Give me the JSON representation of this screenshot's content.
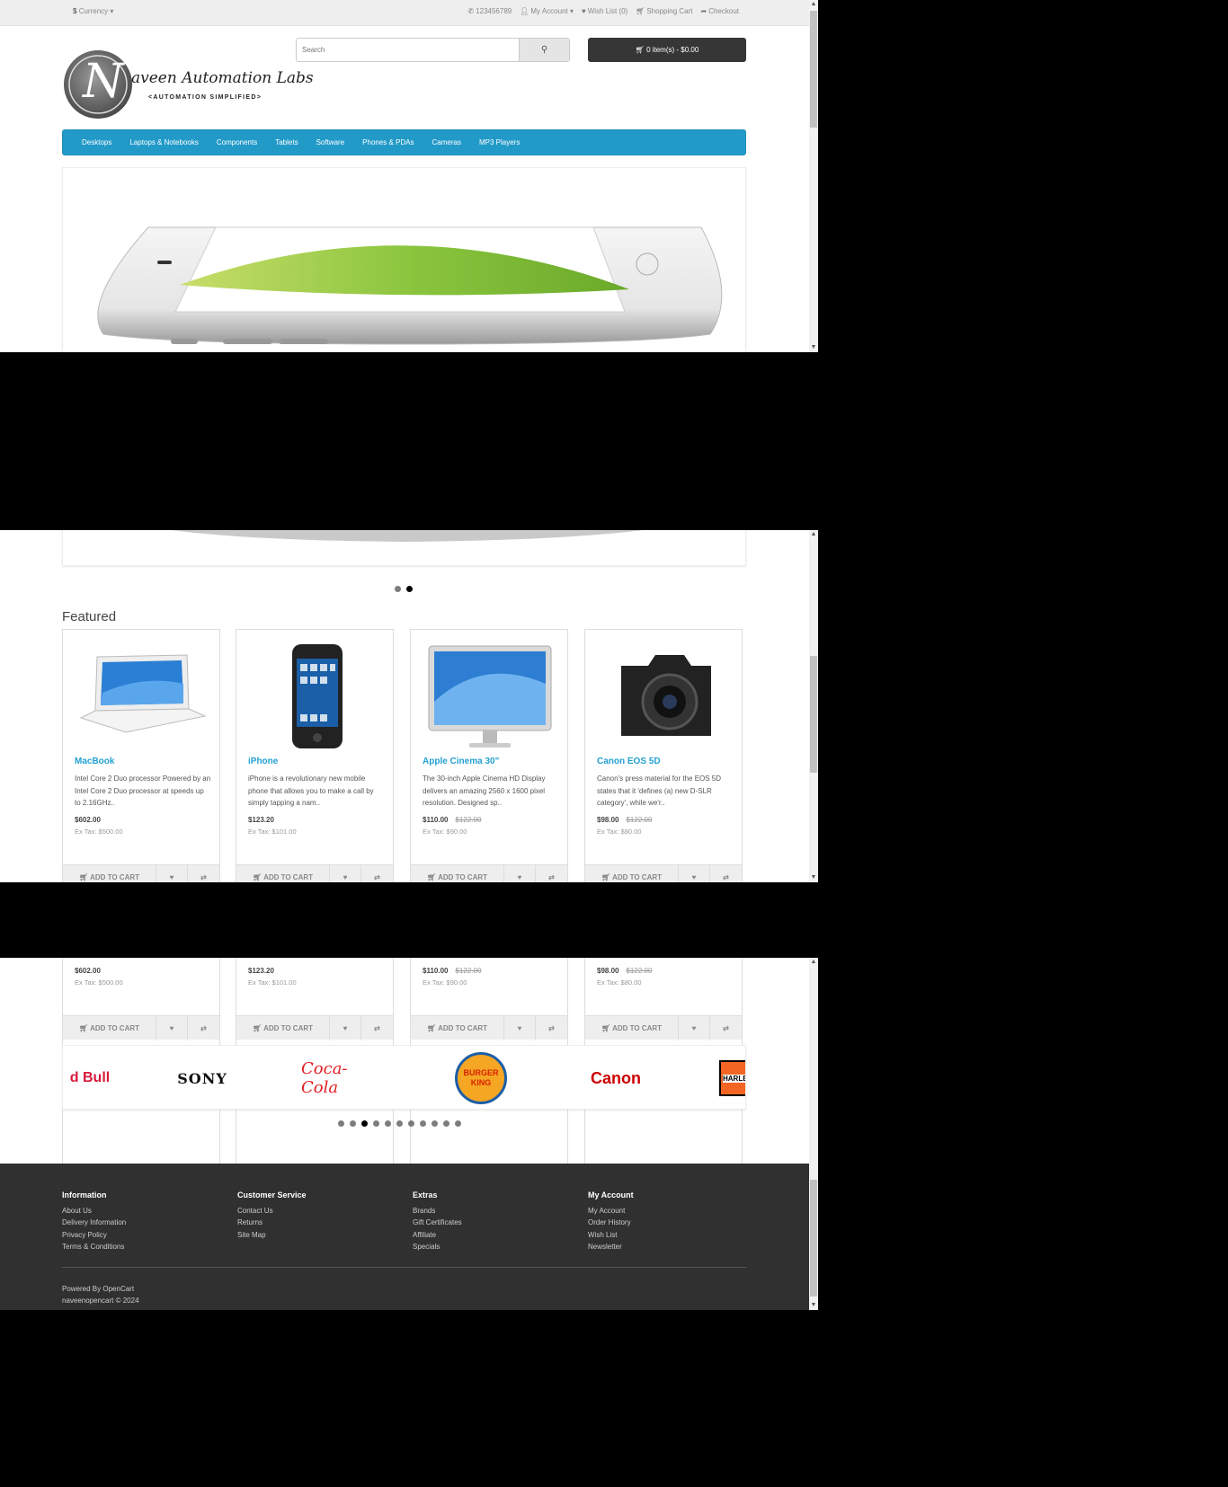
{
  "topbar": {
    "currency_symbol": "$",
    "currency_label": "Currency",
    "phone": "123456789",
    "my_account": "My Account",
    "wish_list": "Wish List (0)",
    "shopping_cart": "Shopping Cart",
    "checkout": "Checkout"
  },
  "logo": {
    "letter": "N",
    "name": "aveen Automation Labs",
    "tagline": "<AUTOMATION SIMPLIFIED>"
  },
  "search": {
    "placeholder": "Search"
  },
  "cart": {
    "label": "0 item(s) - $0.00"
  },
  "menu": [
    "Desktops",
    "Laptops & Notebooks",
    "Components",
    "Tablets",
    "Software",
    "Phones & PDAs",
    "Cameras",
    "MP3 Players"
  ],
  "featured": {
    "heading": "Featured",
    "add_to_cart": "ADD TO CART",
    "products": [
      {
        "name": "MacBook",
        "desc": "Intel Core 2 Duo processor Powered by an Intel Core 2 Duo processor at speeds up to 2.16GHz..",
        "price": "$602.00",
        "old_price": "",
        "ex_tax": "Ex Tax: $500.00"
      },
      {
        "name": "iPhone",
        "desc": "iPhone is a revolutionary new mobile phone that allows you to make a call by simply tapping a nam..",
        "price": "$123.20",
        "old_price": "",
        "ex_tax": "Ex Tax: $101.00"
      },
      {
        "name": "Apple Cinema 30\"",
        "desc": "The 30-inch Apple Cinema HD Display delivers an amazing 2560 x 1600 pixel resolution. Designed sp..",
        "price": "$110.00",
        "old_price": "$122.00",
        "ex_tax": "Ex Tax: $90.00"
      },
      {
        "name": "Canon EOS 5D",
        "desc": "Canon's press material for the EOS 5D states that it 'defines (a) new D-SLR category', while we'r..",
        "price": "$98.00",
        "old_price": "$122.00",
        "ex_tax": "Ex Tax: $80.00"
      }
    ]
  },
  "brands": [
    "d Bull",
    "SONY",
    "Coca-Cola",
    "BURGER KING",
    "Canon",
    "HARLE"
  ],
  "footer": {
    "columns": [
      {
        "title": "Information",
        "links": [
          "About Us",
          "Delivery Information",
          "Privacy Policy",
          "Terms & Conditions"
        ]
      },
      {
        "title": "Customer Service",
        "links": [
          "Contact Us",
          "Returns",
          "Site Map"
        ]
      },
      {
        "title": "Extras",
        "links": [
          "Brands",
          "Gift Certificates",
          "Affiliate",
          "Specials"
        ]
      },
      {
        "title": "My Account",
        "links": [
          "My Account",
          "Order History",
          "Wish List",
          "Newsletter"
        ]
      }
    ],
    "powered_by": "Powered By",
    "opencart": "OpenCart",
    "copyright": "naveenopencart © 2024"
  },
  "colors": {
    "menu": "#229ac8",
    "link": "#23a1d1",
    "footer": "#303030",
    "cart_button": "#363636"
  }
}
